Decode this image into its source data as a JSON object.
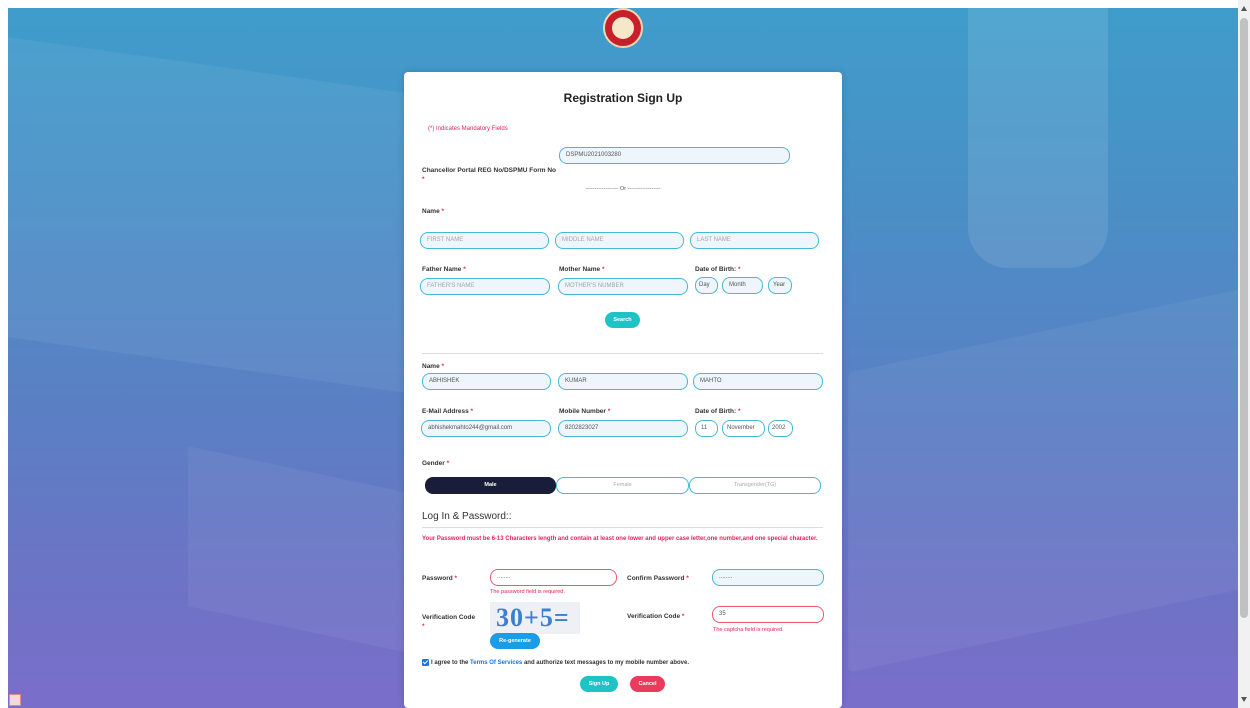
{
  "title": "Registration Sign Up",
  "mandatory_note": "(*) Indicates Mandatory Fields",
  "reg_no": {
    "label": "Chancellor Portal REG No/DSPMU Form No",
    "value": "DSPMU2021003280"
  },
  "or_text": "------------------ Or ------------------",
  "search_section": {
    "name_label": "Name",
    "first_name_placeholder": "FIRST NAME",
    "middle_name_placeholder": "MIDDLE NAME",
    "last_name_placeholder": "LAST NAME",
    "father_label": "Father Name",
    "father_placeholder": "FATHER'S NAME",
    "mother_label": "Mother Name",
    "mother_placeholder": "MOTHER'S NUMBER",
    "dob_label": "Date of Birth:",
    "day_placeholder": "Day",
    "month_placeholder": "Month",
    "year_placeholder": "Year",
    "search_button": "Search"
  },
  "details": {
    "name_label": "Name",
    "first_name": "ABHISHEK",
    "middle_name": "KUMAR",
    "last_name": "MAHTO",
    "email_label": "E-Mail Address",
    "email": "abhishekmahto244@gmail.com",
    "mobile_label": "Mobile Number",
    "mobile": "8202823027",
    "dob_label": "Date of Birth:",
    "dob_day": "11",
    "dob_month": "November",
    "dob_year": "2002"
  },
  "gender": {
    "label": "Gender",
    "options": [
      "Male",
      "Female",
      "Transgender(TG)"
    ],
    "selected": "Male"
  },
  "login": {
    "section_title": "Log In & Password::",
    "password_rule": "Your Password must be 6-13 Characters length and contain at least one lower and upper case letter,one number,and one special character.",
    "password_label": "Password",
    "password_value": "........",
    "password_error": "The password field is required.",
    "confirm_label": "Confirm Password",
    "confirm_value": "........",
    "verification_label_left": "Verification Code",
    "captcha_text": "30+5=",
    "regenerate_button": "Re-generate",
    "verification_label_right": "Verification Code",
    "verification_value": "35",
    "captcha_error": "The captcha field is required."
  },
  "agreement": {
    "prefix": "I agree to the ",
    "link": "Terms Of Services",
    "suffix": " and authorize text messages to my mobile number above."
  },
  "buttons": {
    "signup": "Sign Up",
    "cancel": "Cancel"
  },
  "colors": {
    "accent_teal": "#1fc3c5",
    "button_blue": "#1a9de6",
    "button_red": "#ec3a5c",
    "error_red": "#e0245e",
    "selected_segment": "#1a1d3a"
  }
}
